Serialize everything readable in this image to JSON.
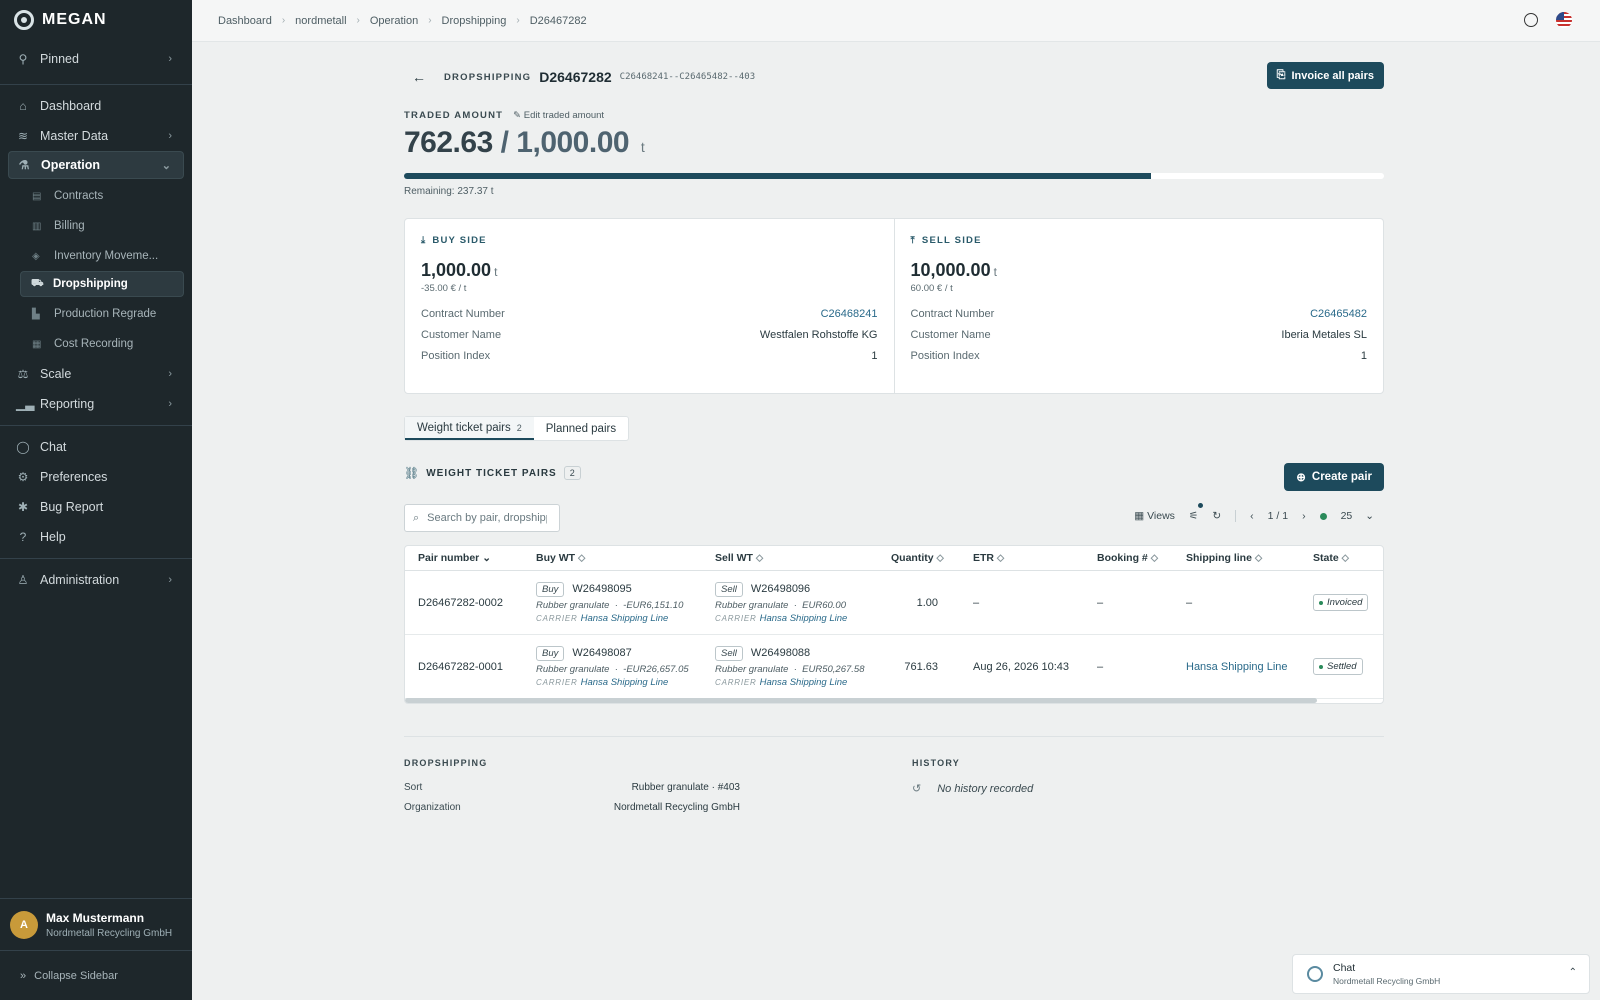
{
  "app": {
    "name": "MEGAN"
  },
  "sidebar": {
    "pinned": "Pinned",
    "dashboard": "Dashboard",
    "master_data": "Master Data",
    "operation": "Operation",
    "operation_items": [
      "Contracts",
      "Billing",
      "Inventory Moveme...",
      "Dropshipping",
      "Production Regrade",
      "Cost Recording"
    ],
    "scale": "Scale",
    "reporting": "Reporting",
    "chat": "Chat",
    "preferences": "Preferences",
    "bug_report": "Bug Report",
    "help": "Help",
    "administration": "Administration",
    "user": {
      "initial": "A",
      "name": "Max Mustermann",
      "org": "Nordmetall Recycling GmbH"
    },
    "collapse": "Collapse Sidebar"
  },
  "breadcrumbs": [
    "Dashboard",
    "nordmetall",
    "Operation",
    "Dropshipping",
    "D26467282"
  ],
  "header": {
    "kicker": "DROPSHIPPING",
    "title": "D26467282",
    "subcode": "C26468241--C26465482--403",
    "invoice_btn": "Invoice all pairs"
  },
  "traded": {
    "label": "TRADED AMOUNT",
    "edit": "Edit traded amount",
    "current": "762.63",
    "slash": "/",
    "total": "1,000.00",
    "unit": "t",
    "progress": 0.7626,
    "remaining": "Remaining: 237.37 t"
  },
  "buy_side": {
    "label": "BUY SIDE",
    "qty": "1,000.00",
    "unit": "t",
    "price": "-35.00 € / t",
    "contract_label": "Contract Number",
    "contract": "C26468241",
    "customer_label": "Customer Name",
    "customer": "Westfalen Rohstoffe KG",
    "position_label": "Position Index",
    "position": "1"
  },
  "sell_side": {
    "label": "SELL SIDE",
    "qty": "10,000.00",
    "unit": "t",
    "price": "60.00 € / t",
    "contract_label": "Contract Number",
    "contract": "C26465482",
    "customer_label": "Customer Name",
    "customer": "Iberia Metales SL",
    "position_label": "Position Index",
    "position": "1"
  },
  "tabs": {
    "weight": "Weight ticket pairs",
    "weight_count": "2",
    "planned": "Planned pairs"
  },
  "section": {
    "title": "WEIGHT TICKET PAIRS",
    "count": "2",
    "create": "Create pair"
  },
  "search": {
    "placeholder": "Search by pair, dropshipping"
  },
  "toolbar": {
    "views": "Views",
    "page": "1 / 1",
    "page_size": "25"
  },
  "table": {
    "columns": [
      "Pair number",
      "Buy WT",
      "Sell WT",
      "Quantity",
      "ETR",
      "Booking #",
      "Shipping line",
      "State"
    ],
    "rows": [
      {
        "pair": "D26467282-0002",
        "buy": {
          "tag": "Buy",
          "num": "W26498095",
          "sort": "Rubber granulate",
          "amount": "-EUR6,151.10",
          "carrier_label": "CARRIER",
          "carrier": "Hansa Shipping Line"
        },
        "sell": {
          "tag": "Sell",
          "num": "W26498096",
          "sort": "Rubber granulate",
          "amount": "EUR60.00",
          "carrier_label": "CARRIER",
          "carrier": "Hansa Shipping Line"
        },
        "quantity": "1.00",
        "etr": "–",
        "booking": "–",
        "shipping": "–",
        "state": "Invoiced"
      },
      {
        "pair": "D26467282-0001",
        "buy": {
          "tag": "Buy",
          "num": "W26498087",
          "sort": "Rubber granulate",
          "amount": "-EUR26,657.05",
          "carrier_label": "CARRIER",
          "carrier": "Hansa Shipping Line"
        },
        "sell": {
          "tag": "Sell",
          "num": "W26498088",
          "sort": "Rubber granulate",
          "amount": "EUR50,267.58",
          "carrier_label": "CARRIER",
          "carrier": "Hansa Shipping Line"
        },
        "quantity": "761.63",
        "etr": "Aug 26, 2026 10:43",
        "booking": "–",
        "shipping": "Hansa Shipping Line",
        "state": "Settled"
      }
    ]
  },
  "footer": {
    "dropshipping_title": "DROPSHIPPING",
    "sort_label": "Sort",
    "sort": "Rubber granulate · #403",
    "org_label": "Organization",
    "org": "Nordmetall Recycling GmbH",
    "history_title": "HISTORY",
    "history_empty": "No history recorded"
  },
  "chat_popup": {
    "title": "Chat",
    "org": "Nordmetall Recycling GmbH"
  }
}
